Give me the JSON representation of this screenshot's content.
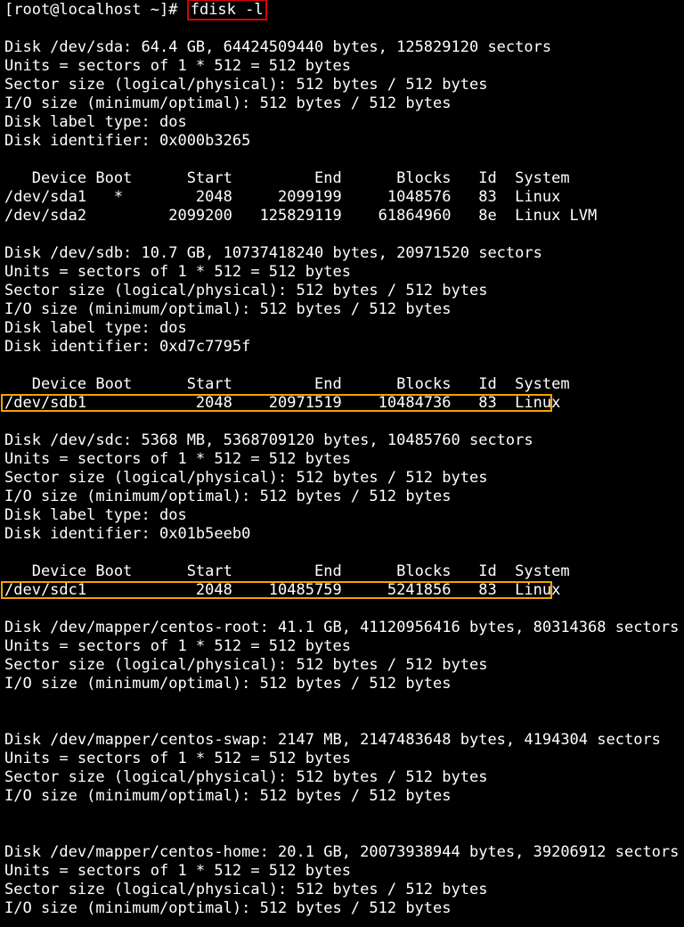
{
  "prompt": "[root@localhost ~]#",
  "command": "fdisk -l",
  "lines": {
    "sda_header": "Disk /dev/sda: 64.4 GB, 64424509440 bytes, 125829120 sectors",
    "sda_units": "Units = sectors of 1 * 512 = 512 bytes",
    "sda_sector": "Sector size (logical/physical): 512 bytes / 512 bytes",
    "sda_io": "I/O size (minimum/optimal): 512 bytes / 512 bytes",
    "sda_label": "Disk label type: dos",
    "sda_ident": "Disk identifier: 0x000b3265",
    "sda_table_header": "   Device Boot      Start         End      Blocks   Id  System",
    "sda1": "/dev/sda1   *        2048     2099199     1048576   83  Linux",
    "sda2": "/dev/sda2         2099200   125829119    61864960   8e  Linux LVM",
    "sdb_header": "Disk /dev/sdb: 10.7 GB, 10737418240 bytes, 20971520 sectors",
    "sdb_units": "Units = sectors of 1 * 512 = 512 bytes",
    "sdb_sector": "Sector size (logical/physical): 512 bytes / 512 bytes",
    "sdb_io": "I/O size (minimum/optimal): 512 bytes / 512 bytes",
    "sdb_label": "Disk label type: dos",
    "sdb_ident": "Disk identifier: 0xd7c7795f",
    "sdb_table_header": "   Device Boot      Start         End      Blocks   Id  System",
    "sdb1": "/dev/sdb1            2048    20971519    10484736   83  Linux",
    "sdc_header": "Disk /dev/sdc: 5368 MB, 5368709120 bytes, 10485760 sectors",
    "sdc_units": "Units = sectors of 1 * 512 = 512 bytes",
    "sdc_sector": "Sector size (logical/physical): 512 bytes / 512 bytes",
    "sdc_io": "I/O size (minimum/optimal): 512 bytes / 512 bytes",
    "sdc_label": "Disk label type: dos",
    "sdc_ident": "Disk identifier: 0x01b5eeb0",
    "sdc_table_header": "   Device Boot      Start         End      Blocks   Id  System",
    "sdc1": "/dev/sdc1            2048    10485759     5241856   83  Linux",
    "root_header": "Disk /dev/mapper/centos-root: 41.1 GB, 41120956416 bytes, 80314368 sectors",
    "root_units": "Units = sectors of 1 * 512 = 512 bytes",
    "root_sector": "Sector size (logical/physical): 512 bytes / 512 bytes",
    "root_io": "I/O size (minimum/optimal): 512 bytes / 512 bytes",
    "swap_header": "Disk /dev/mapper/centos-swap: 2147 MB, 2147483648 bytes, 4194304 sectors",
    "swap_units": "Units = sectors of 1 * 512 = 512 bytes",
    "swap_sector": "Sector size (logical/physical): 512 bytes / 512 bytes",
    "swap_io": "I/O size (minimum/optimal): 512 bytes / 512 bytes",
    "home_header": "Disk /dev/mapper/centos-home: 20.1 GB, 20073938944 bytes, 39206912 sectors",
    "home_units": "Units = sectors of 1 * 512 = 512 bytes",
    "home_sector": "Sector size (logical/physical): 512 bytes / 512 bytes",
    "home_io": "I/O size (minimum/optimal): 512 bytes / 512 bytes"
  },
  "highlight_colors": {
    "command_box": "#e00000",
    "partition_box": "#f5a300"
  }
}
